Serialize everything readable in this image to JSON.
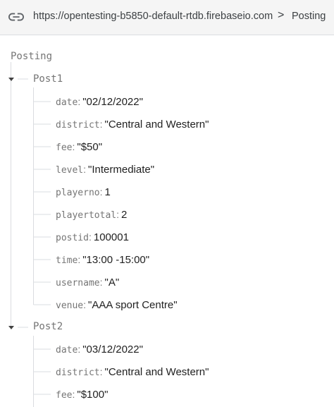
{
  "toolbar": {
    "url": "https://opentesting-b5850-default-rtdb.firebaseio.com",
    "separator": ">",
    "current": "Posting"
  },
  "tree": {
    "root": "Posting",
    "posts": [
      {
        "name": "Post1",
        "fields": [
          {
            "key": "date",
            "value": "\"02/12/2022\""
          },
          {
            "key": "district",
            "value": "\"Central and Western\""
          },
          {
            "key": "fee",
            "value": "\"$50\""
          },
          {
            "key": "level",
            "value": "\"Intermediate\""
          },
          {
            "key": "playerno",
            "value": "1"
          },
          {
            "key": "playertotal",
            "value": "2"
          },
          {
            "key": "postid",
            "value": "100001"
          },
          {
            "key": "time",
            "value": "\"13:00 -15:00\""
          },
          {
            "key": "username",
            "value": "\"A\""
          },
          {
            "key": "venue",
            "value": "\"AAA sport Centre\""
          }
        ]
      },
      {
        "name": "Post2",
        "fields": [
          {
            "key": "date",
            "value": "\"03/12/2022\""
          },
          {
            "key": "district",
            "value": "\"Central and Western\""
          },
          {
            "key": "fee",
            "value": "\"$100\""
          }
        ]
      }
    ]
  }
}
